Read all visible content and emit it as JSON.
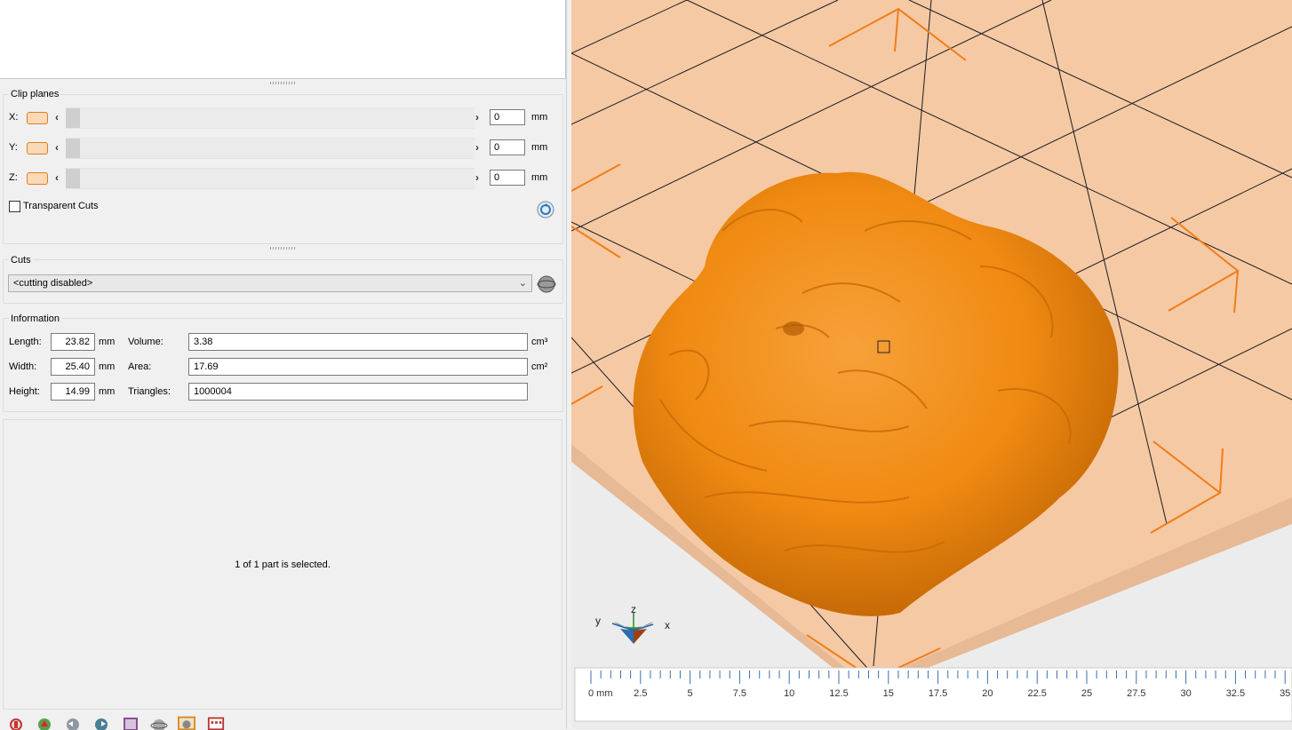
{
  "clip_planes": {
    "title": "Clip planes",
    "axes": [
      {
        "label": "X:",
        "value": "0",
        "unit": "mm"
      },
      {
        "label": "Y:",
        "value": "0",
        "unit": "mm"
      },
      {
        "label": "Z:",
        "value": "0",
        "unit": "mm"
      }
    ],
    "transparent_cuts_label": "Transparent Cuts"
  },
  "cuts": {
    "title": "Cuts",
    "selected": "<cutting disabled>"
  },
  "information": {
    "title": "Information",
    "length_label": "Length:",
    "length": "23.82",
    "length_unit": "mm",
    "width_label": "Width:",
    "width": "25.40",
    "width_unit": "mm",
    "height_label": "Height:",
    "height": "14.99",
    "height_unit": "mm",
    "volume_label": "Volume:",
    "volume": "3.38",
    "volume_unit": "cm³",
    "area_label": "Area:",
    "area": "17.69",
    "area_unit": "cm²",
    "triangles_label": "Triangles:",
    "triangles": "1000004"
  },
  "status": {
    "selection_text": "1 of 1 part is selected."
  },
  "viewport": {
    "axis_labels": {
      "x": "x",
      "y": "y",
      "z": "z"
    },
    "ruler_ticks": [
      "0 mm",
      "2.5",
      "5",
      "7.5",
      "10",
      "12.5",
      "15",
      "17.5",
      "20",
      "22.5",
      "25",
      "27.5",
      "30",
      "32.5",
      "35"
    ],
    "colors": {
      "model": "#f08a12",
      "plate": "#f5c9a3",
      "frame": "#f07d1a",
      "background": "#ececec"
    }
  },
  "toolbar_icons": [
    "settings-icon",
    "pdf-icon",
    "undo-icon",
    "redo-icon",
    "box-icon",
    "sphere-icon",
    "cube-selected-icon",
    "calendar-icon"
  ]
}
